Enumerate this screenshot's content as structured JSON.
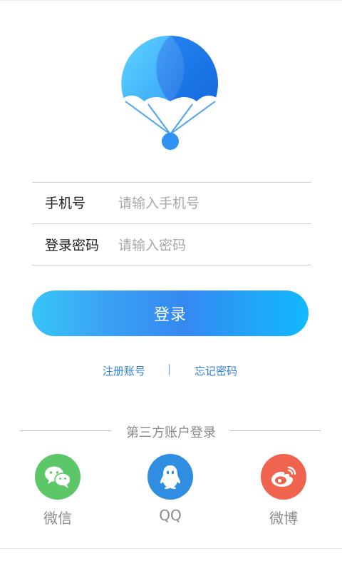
{
  "form": {
    "phone_label": "手机号",
    "phone_placeholder": "请输入手机号",
    "phone_value": "",
    "password_label": "登录密码",
    "password_placeholder": "请输入密码",
    "password_value": ""
  },
  "login_button": "登录",
  "links": {
    "register": "注册账号",
    "separator": "|",
    "forgot": "忘记密码"
  },
  "third_party": {
    "title": "第三方账户登录",
    "items": [
      {
        "label": "微信",
        "icon": "wechat-icon",
        "color": "#5bc767"
      },
      {
        "label": "QQ",
        "icon": "qq-icon",
        "color": "#2f8de2"
      },
      {
        "label": "微博",
        "icon": "weibo-icon",
        "color": "#f0644f"
      }
    ]
  },
  "colors": {
    "accent": "#3a9cf3",
    "link": "#2d7fd8"
  }
}
